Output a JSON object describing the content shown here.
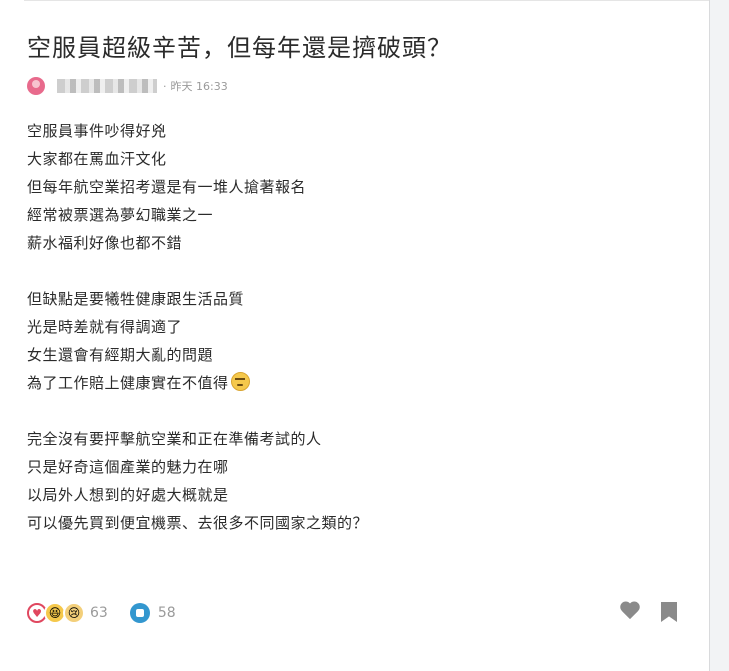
{
  "post": {
    "title": "空服員超級辛苦，但每年還是擠破頭？",
    "timestamp": "昨天 16:33",
    "separator": "·",
    "body": {
      "p1": [
        "空服員事件吵得好兇",
        "大家都在罵血汗文化",
        "但每年航空業招考還是有一堆人搶著報名",
        "經常被票選為夢幻職業之一",
        "薪水福利好像也都不錯"
      ],
      "p2": [
        "但缺點是要犧牲健康跟生活品質",
        "光是時差就有得調適了",
        "女生還會有經期大亂的問題",
        "為了工作賠上健康實在不值得"
      ],
      "p3": [
        "完全沒有要抨擊航空業和正在準備考試的人",
        "只是好奇這個產業的魅力在哪",
        "以局外人想到的好處大概就是",
        "可以優先買到便宜機票、去很多不同國家之類的？"
      ]
    }
  },
  "footer": {
    "reaction_count": "63",
    "comment_count": "58"
  },
  "icons": {
    "heart_react": "♥",
    "laugh_react": "😆",
    "cry_react": "😢"
  },
  "colors": {
    "accent_comment": "#3397cf",
    "heart_react": "#e0475f",
    "avatar": "#e86a8c"
  }
}
